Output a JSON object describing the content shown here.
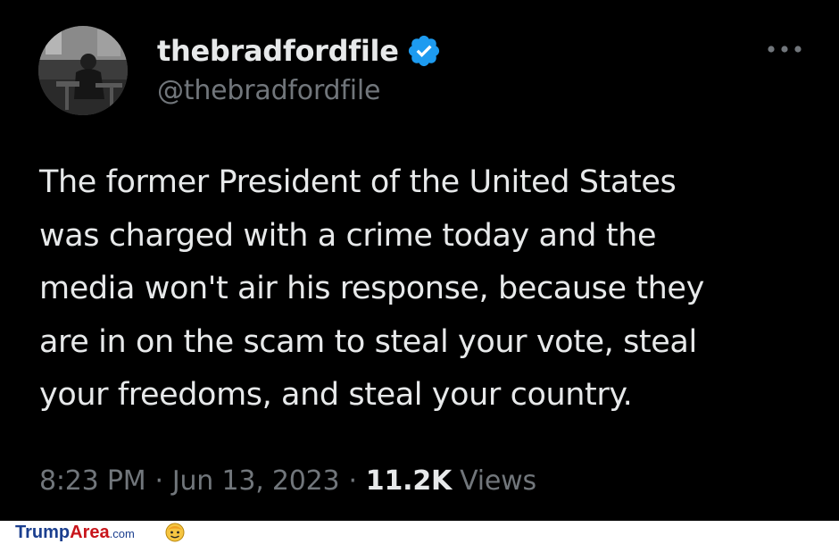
{
  "tweet": {
    "display_name": "thebradfordfile",
    "handle": "@thebradfordfile",
    "verified": true,
    "body_lines": [
      "The former President of the United States",
      "was charged with a crime today and the",
      "media won't air his response, because they",
      "are in on the scam to steal your vote, steal",
      "your freedoms, and steal your country."
    ],
    "time": "8:23 PM",
    "separator": "·",
    "date": "Jun 13, 2023",
    "views_count": "11.2K",
    "views_label": "Views",
    "more_icon": "more-horizontal-icon"
  },
  "footer": {
    "brand_part1": "Trump",
    "brand_part2": "Area",
    "brand_part3": ".com",
    "brand_icon": "mascot-face-icon"
  },
  "colors": {
    "background": "#000000",
    "text_primary": "#e7e9ea",
    "text_secondary": "#71767b",
    "verified_blue": "#1d9bf0",
    "footer_background": "#ffffff",
    "brand_blue": "#1b3f8f",
    "brand_red": "#c8151b"
  }
}
